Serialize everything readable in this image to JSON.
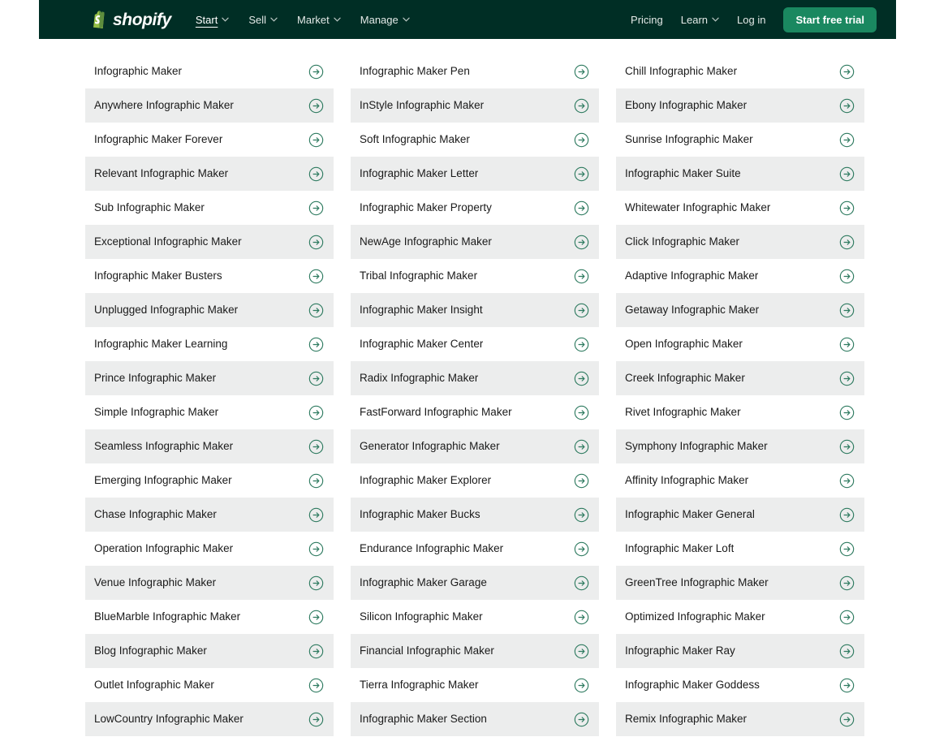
{
  "header": {
    "logo_text": "shopify",
    "logo_icon": "shopify-bag-icon",
    "background_color": "#002e25",
    "nav_left": [
      {
        "label": "Start",
        "has_chevron": true,
        "active": true
      },
      {
        "label": "Sell",
        "has_chevron": true,
        "active": false
      },
      {
        "label": "Market",
        "has_chevron": true,
        "active": false
      },
      {
        "label": "Manage",
        "has_chevron": true,
        "active": false
      }
    ],
    "nav_right": [
      {
        "label": "Pricing",
        "has_chevron": false
      },
      {
        "label": "Learn",
        "has_chevron": true
      },
      {
        "label": "Log in",
        "has_chevron": false
      }
    ],
    "cta_label": "Start free trial",
    "cta_color": "#1a8860"
  },
  "grid": {
    "arrow_icon": "arrow-right-circle-icon",
    "accent_color": "#2d7a5f",
    "alt_row_color": "#eceded",
    "rows": [
      [
        "Infographic Maker",
        "Infographic Maker Pen",
        "Chill Infographic Maker"
      ],
      [
        "Anywhere Infographic Maker",
        "InStyle Infographic Maker",
        "Ebony Infographic Maker"
      ],
      [
        "Infographic Maker Forever",
        "Soft Infographic Maker",
        "Sunrise Infographic Maker"
      ],
      [
        "Relevant Infographic Maker",
        "Infographic Maker Letter",
        "Infographic Maker Suite"
      ],
      [
        "Sub Infographic Maker",
        "Infographic Maker Property",
        "Whitewater Infographic Maker"
      ],
      [
        "Exceptional Infographic Maker",
        "NewAge Infographic Maker",
        "Click Infographic Maker"
      ],
      [
        "Infographic Maker Busters",
        "Tribal Infographic Maker",
        "Adaptive Infographic Maker"
      ],
      [
        "Unplugged Infographic Maker",
        "Infographic Maker Insight",
        "Getaway Infographic Maker"
      ],
      [
        "Infographic Maker Learning",
        "Infographic Maker Center",
        "Open Infographic Maker"
      ],
      [
        "Prince Infographic Maker",
        "Radix Infographic Maker",
        "Creek Infographic Maker"
      ],
      [
        "Simple Infographic Maker",
        "FastForward Infographic Maker",
        "Rivet Infographic Maker"
      ],
      [
        "Seamless Infographic Maker",
        "Generator Infographic Maker",
        "Symphony Infographic Maker"
      ],
      [
        "Emerging Infographic Maker",
        "Infographic Maker Explorer",
        "Affinity Infographic Maker"
      ],
      [
        "Chase Infographic Maker",
        "Infographic Maker Bucks",
        "Infographic Maker General"
      ],
      [
        "Operation Infographic Maker",
        "Endurance Infographic Maker",
        "Infographic Maker Loft"
      ],
      [
        "Venue Infographic Maker",
        "Infographic Maker Garage",
        "GreenTree Infographic Maker"
      ],
      [
        "BlueMarble Infographic Maker",
        "Silicon Infographic Maker",
        "Optimized Infographic Maker"
      ],
      [
        "Blog Infographic Maker",
        "Financial Infographic Maker",
        "Infographic Maker Ray"
      ],
      [
        "Outlet Infographic Maker",
        "Tierra Infographic Maker",
        "Infographic Maker Goddess"
      ],
      [
        "LowCountry Infographic Maker",
        "Infographic Maker Section",
        "Remix Infographic Maker"
      ]
    ]
  }
}
